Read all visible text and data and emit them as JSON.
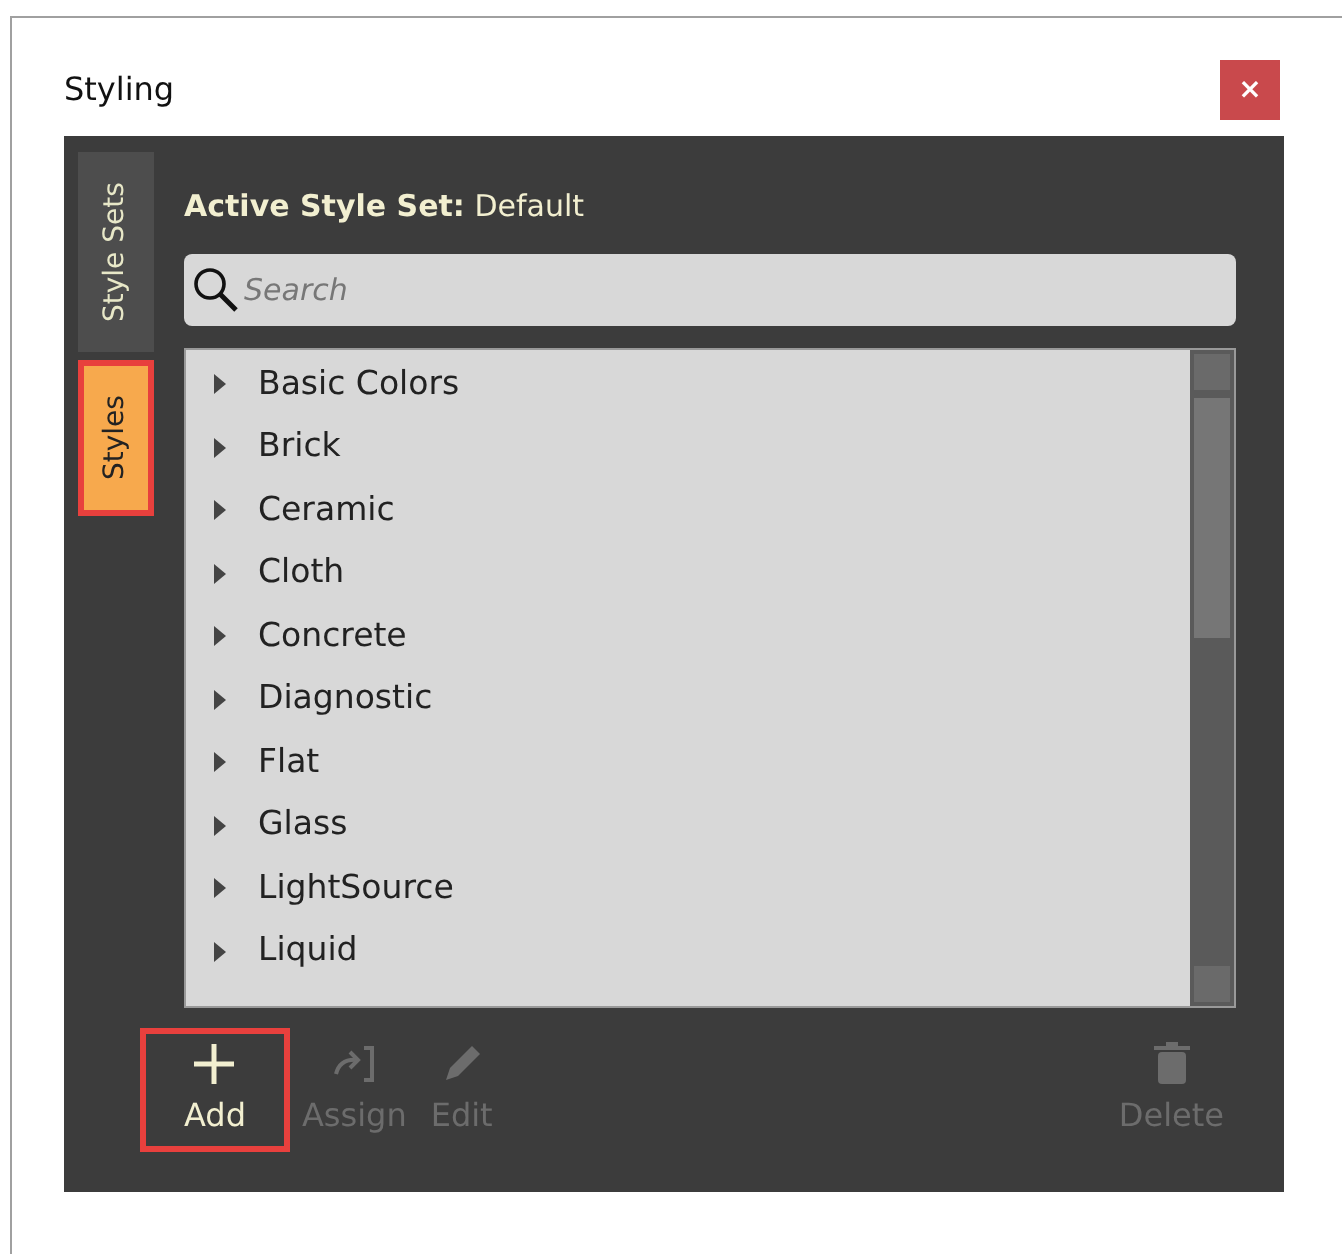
{
  "window": {
    "title": "Styling",
    "close": "×"
  },
  "side_tabs": [
    {
      "label": "Style Sets",
      "selected": false,
      "highlighted": false
    },
    {
      "label": "Styles",
      "selected": true,
      "highlighted": true
    }
  ],
  "header": {
    "label": "Active Style Set:",
    "value": "Default"
  },
  "search": {
    "placeholder": "Search"
  },
  "items": [
    {
      "label": "Basic Colors"
    },
    {
      "label": "Brick"
    },
    {
      "label": "Ceramic"
    },
    {
      "label": "Cloth"
    },
    {
      "label": "Concrete"
    },
    {
      "label": "Diagnostic"
    },
    {
      "label": "Flat"
    },
    {
      "label": "Glass"
    },
    {
      "label": "LightSource"
    },
    {
      "label": "Liquid"
    }
  ],
  "toolbar": [
    {
      "kind": "add",
      "label": "Add",
      "disabled": false,
      "highlighted": true
    },
    {
      "kind": "assign",
      "label": "Assign",
      "disabled": true,
      "highlighted": false
    },
    {
      "kind": "edit",
      "label": "Edit",
      "disabled": true,
      "highlighted": false
    },
    {
      "kind": "delete",
      "label": "Delete",
      "disabled": true,
      "highlighted": false
    }
  ]
}
